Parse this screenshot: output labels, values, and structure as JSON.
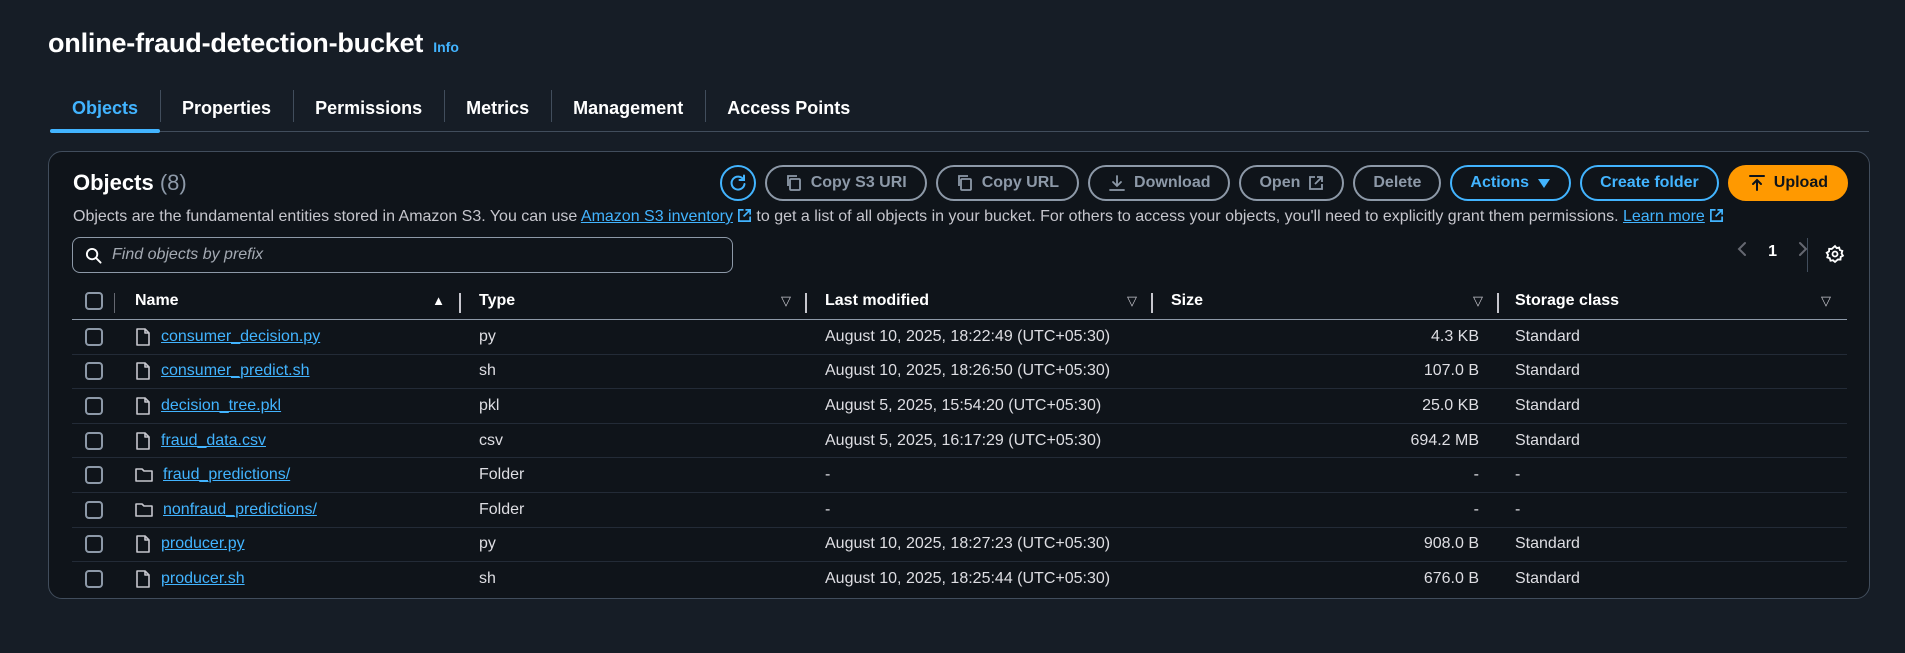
{
  "header": {
    "title": "online-fraud-detection-bucket",
    "info": "Info"
  },
  "tabs": [
    {
      "label": "Objects",
      "active": true
    },
    {
      "label": "Properties"
    },
    {
      "label": "Permissions"
    },
    {
      "label": "Metrics"
    },
    {
      "label": "Management"
    },
    {
      "label": "Access Points"
    }
  ],
  "objects": {
    "heading": "Objects",
    "count": "(8)",
    "description_pre": "Objects are the fundamental entities stored in Amazon S3. You can use ",
    "inventory_link": "Amazon S3 inventory",
    "description_mid": " to get a list of all objects in your bucket. For others to access your objects, you'll need to explicitly grant them permissions. ",
    "learn_more": "Learn more",
    "toolbar": {
      "copy_s3_uri": "Copy S3 URI",
      "copy_url": "Copy URL",
      "download": "Download",
      "open": "Open",
      "delete": "Delete",
      "actions": "Actions",
      "create_folder": "Create folder",
      "upload": "Upload"
    },
    "search_placeholder": "Find objects by prefix",
    "page": "1",
    "columns": {
      "name": "Name",
      "type": "Type",
      "last_modified": "Last modified",
      "size": "Size",
      "storage_class": "Storage class"
    },
    "rows": [
      {
        "name": "consumer_decision.py",
        "kind": "file",
        "type": "py",
        "modified": "August 10, 2025, 18:22:49 (UTC+05:30)",
        "size": "4.3 KB",
        "class": "Standard"
      },
      {
        "name": "consumer_predict.sh",
        "kind": "file",
        "type": "sh",
        "modified": "August 10, 2025, 18:26:50 (UTC+05:30)",
        "size": "107.0 B",
        "class": "Standard"
      },
      {
        "name": "decision_tree.pkl",
        "kind": "file",
        "type": "pkl",
        "modified": "August 5, 2025, 15:54:20 (UTC+05:30)",
        "size": "25.0 KB",
        "class": "Standard"
      },
      {
        "name": "fraud_data.csv",
        "kind": "file",
        "type": "csv",
        "modified": "August 5, 2025, 16:17:29 (UTC+05:30)",
        "size": "694.2 MB",
        "class": "Standard"
      },
      {
        "name": "fraud_predictions/",
        "kind": "folder",
        "type": "Folder",
        "modified": "-",
        "size": "-",
        "class": "-"
      },
      {
        "name": "nonfraud_predictions/",
        "kind": "folder",
        "type": "Folder",
        "modified": "-",
        "size": "-",
        "class": "-"
      },
      {
        "name": "producer.py",
        "kind": "file",
        "type": "py",
        "modified": "August 10, 2025, 18:27:23 (UTC+05:30)",
        "size": "908.0 B",
        "class": "Standard"
      },
      {
        "name": "producer.sh",
        "kind": "file",
        "type": "sh",
        "modified": "August 10, 2025, 18:25:44 (UTC+05:30)",
        "size": "676.0 B",
        "class": "Standard"
      }
    ]
  },
  "colors": {
    "background": "#161d26",
    "panel": "#0f141a",
    "link": "#42b4ff",
    "upload": "#ff9900"
  },
  "icons": [
    "refresh-icon",
    "copy-icon",
    "download-icon",
    "external-link-icon",
    "caret-down-icon",
    "upload-icon",
    "search-icon",
    "chevron-left-icon",
    "chevron-right-icon",
    "gear-icon",
    "file-icon",
    "folder-icon",
    "sort-ascending-icon",
    "sort-icon"
  ]
}
